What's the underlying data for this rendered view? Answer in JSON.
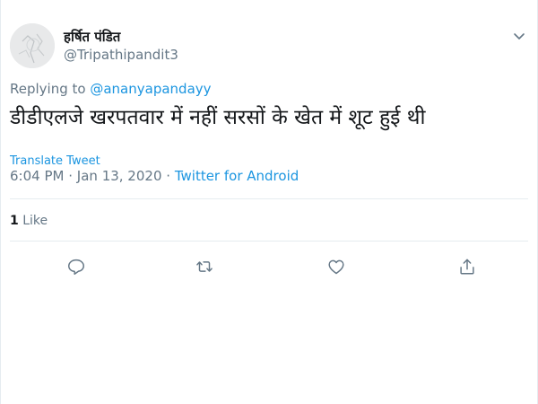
{
  "author": {
    "display_name": "हर्षित पंडित",
    "handle": "@Tripathipandit3"
  },
  "reply": {
    "prefix": "Replying to",
    "mention": "@ananyapandayy"
  },
  "tweet": {
    "text": "डीडीएलजे खरपतवार में नहीं सरसों के खेत में शूट हुई थी",
    "translate_label": "Translate Tweet"
  },
  "meta": {
    "time": "6:04 PM",
    "separator1": "·",
    "date": "Jan 13, 2020",
    "separator2": "·",
    "source": "Twitter for Android"
  },
  "stats": {
    "likes_count": "1",
    "likes_label": "Like"
  },
  "icons": {
    "caret": "chevron-down-icon",
    "reply": "reply-icon",
    "retweet": "retweet-icon",
    "like": "heart-icon",
    "share": "share-icon"
  },
  "colors": {
    "link": "#1b95e0",
    "secondary_text": "#657786",
    "primary_text": "#14171a",
    "divider": "#e6ecf0"
  }
}
